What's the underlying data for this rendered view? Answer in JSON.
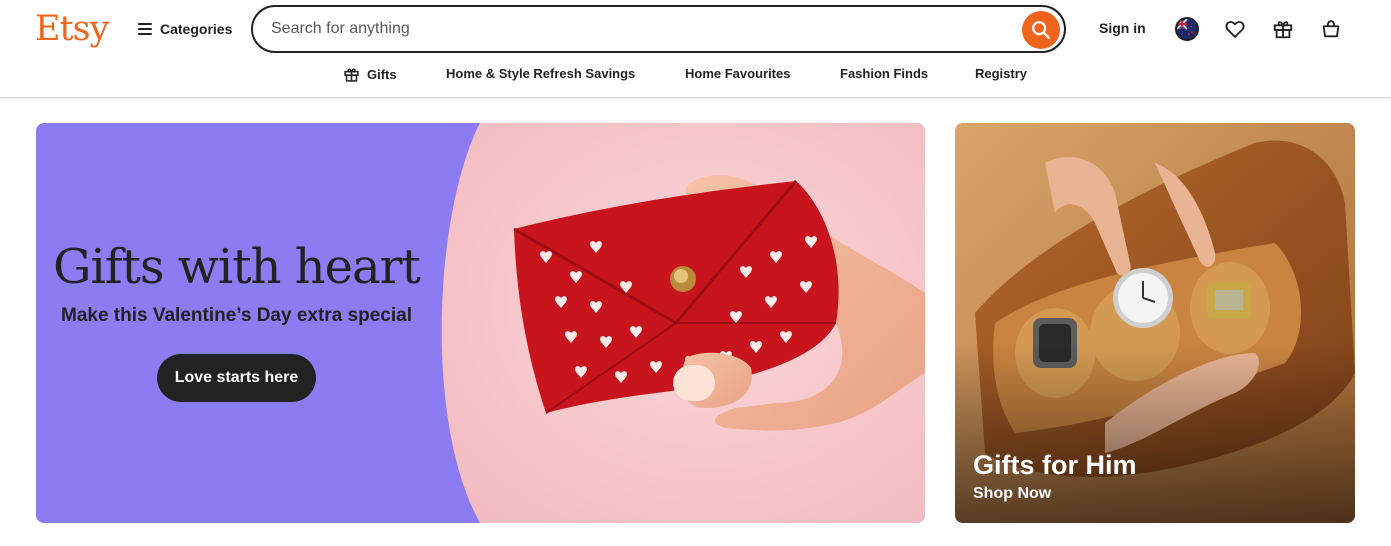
{
  "header": {
    "logo": "Etsy",
    "categories_label": "Categories",
    "search_placeholder": "Search for anything",
    "search_value": "",
    "signin_label": "Sign in"
  },
  "nav": {
    "items": [
      {
        "label": "Gifts",
        "icon": "gift-icon"
      },
      {
        "label": "Home & Style Refresh Savings"
      },
      {
        "label": "Home Favourites"
      },
      {
        "label": "Fashion Finds"
      },
      {
        "label": "Registry"
      }
    ]
  },
  "hero": {
    "title": "Gifts with heart",
    "subtitle": "Make this Valentine’s Day extra special",
    "button_label": "Love starts here",
    "colors": {
      "panel": "#8b7cf2",
      "photo_bg": "#f6c6cb"
    }
  },
  "side_card": {
    "title": "Gifts for Him",
    "link_label": "Shop Now"
  },
  "colors": {
    "brand": "#f1641e",
    "text": "#222222"
  }
}
